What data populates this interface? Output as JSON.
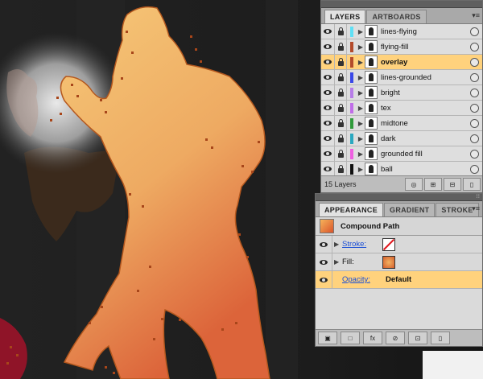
{
  "layers_panel": {
    "tabs": [
      {
        "label": "LAYERS",
        "active": true
      },
      {
        "label": "ARTBOARDS",
        "active": false
      }
    ],
    "layers": [
      {
        "name": "lines-flying",
        "color": "#5fe0f5",
        "selected": false
      },
      {
        "name": "flying-fill",
        "color": "#b34a2b",
        "selected": false
      },
      {
        "name": "overlay",
        "color": "#b34a2b",
        "selected": true
      },
      {
        "name": "lines-grounded",
        "color": "#3a48e8",
        "selected": false
      },
      {
        "name": "bright",
        "color": "#b77de8",
        "selected": false
      },
      {
        "name": "tex",
        "color": "#c06de8",
        "selected": false
      },
      {
        "name": "midtone",
        "color": "#2f9a3a",
        "selected": false
      },
      {
        "name": "dark",
        "color": "#2aa8c0",
        "selected": false
      },
      {
        "name": "grounded fill",
        "color": "#ee5fe0",
        "selected": false
      },
      {
        "name": "ball",
        "color": "#111111",
        "selected": false
      }
    ],
    "layer_count": "15 Layers"
  },
  "appearance_panel": {
    "tabs": [
      {
        "label": "APPEARANCE",
        "active": true
      },
      {
        "label": "GRADIENT",
        "active": false
      },
      {
        "label": "STROKE",
        "active": false
      }
    ],
    "object_type": "Compound Path",
    "stroke_label": "Stroke:",
    "fill_label": "Fill:",
    "opacity_label": "Opacity:",
    "opacity_value": "Default"
  },
  "colors": {
    "selection": "#ffd27d",
    "figure_light": "#f6c878",
    "figure_dark": "#de6a3c"
  }
}
